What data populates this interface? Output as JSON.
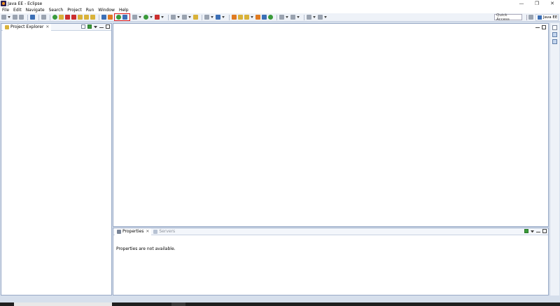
{
  "window": {
    "title": "Java EE - Eclipse",
    "controls": [
      "—",
      "❐",
      "✕"
    ]
  },
  "menu": [
    "File",
    "Edit",
    "Navigate",
    "Search",
    "Project",
    "Run",
    "Window",
    "Help"
  ],
  "toolbar": {
    "quick_access": "Quick Access",
    "perspective": "Java EE"
  },
  "left_panel": {
    "tab_label": "Project Explorer",
    "close": "✕"
  },
  "bottom_panel": {
    "tabs": [
      {
        "label": "Properties",
        "active": true
      },
      {
        "label": "Servers",
        "active": false
      }
    ],
    "close": "✕",
    "message": "Properties are not available."
  },
  "colors": {
    "highlight": "#e01b1b",
    "panel_border": "#98a9c6",
    "background": "#d6dfec"
  }
}
